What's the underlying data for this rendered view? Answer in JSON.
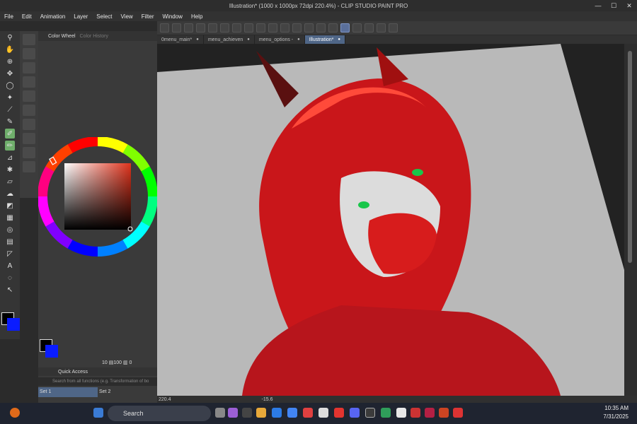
{
  "window": {
    "title": "Illustration* (1000 x 1000px 72dpi 220.4%) - CLIP STUDIO PAINT PRO",
    "controls": [
      "—",
      "☐",
      "✕"
    ]
  },
  "menu": [
    "File",
    "Edit",
    "Animation",
    "Layer",
    "Select",
    "View",
    "Filter",
    "Window",
    "Help"
  ],
  "color_panel": {
    "tabs": [
      "Color Wheel",
      "Color History"
    ],
    "counter": "10 ▤100 ▥ 0"
  },
  "canvas_tabs": [
    {
      "label": "0menu_main*",
      "active": false
    },
    {
      "label": "menu_achieven",
      "active": false
    },
    {
      "label": "menu_options -",
      "active": false
    },
    {
      "label": "Illustration*",
      "active": true
    }
  ],
  "status": {
    "zoom": "220.4",
    "angle": "-15.6"
  },
  "quick_access": {
    "title": "Quick Access",
    "search_placeholder": "Search from all functions (e.g. Transformation of bo",
    "sets": [
      "Set 1",
      "Set 2"
    ]
  },
  "taskbar": {
    "search_label": "Search",
    "time": "10:35 AM",
    "date": "7/31/2025"
  },
  "colors": {
    "foreground": "#000000",
    "background": "#0a1cff",
    "canvas_bg": "#b4b4b4",
    "accent": "#4f6687"
  }
}
